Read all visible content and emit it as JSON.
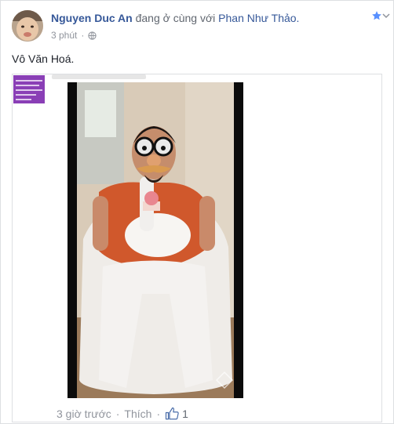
{
  "post": {
    "author": "Nguyen Duc An",
    "verb": "đang ở cùng với",
    "tagged": "Phan Như Thảo.",
    "timestamp": "3 phút",
    "text": "Vô Văn Hoá."
  },
  "shared_item": {
    "timestamp": "3 giờ trước",
    "like_label": "Thích",
    "like_count": "1"
  },
  "icons": {
    "privacy": "globe-icon",
    "save": "star-icon",
    "like": "thumbs-up-icon"
  },
  "colors": {
    "link": "#365899",
    "muted": "#90949c",
    "text": "#1d2129",
    "star": "#5890ff"
  }
}
